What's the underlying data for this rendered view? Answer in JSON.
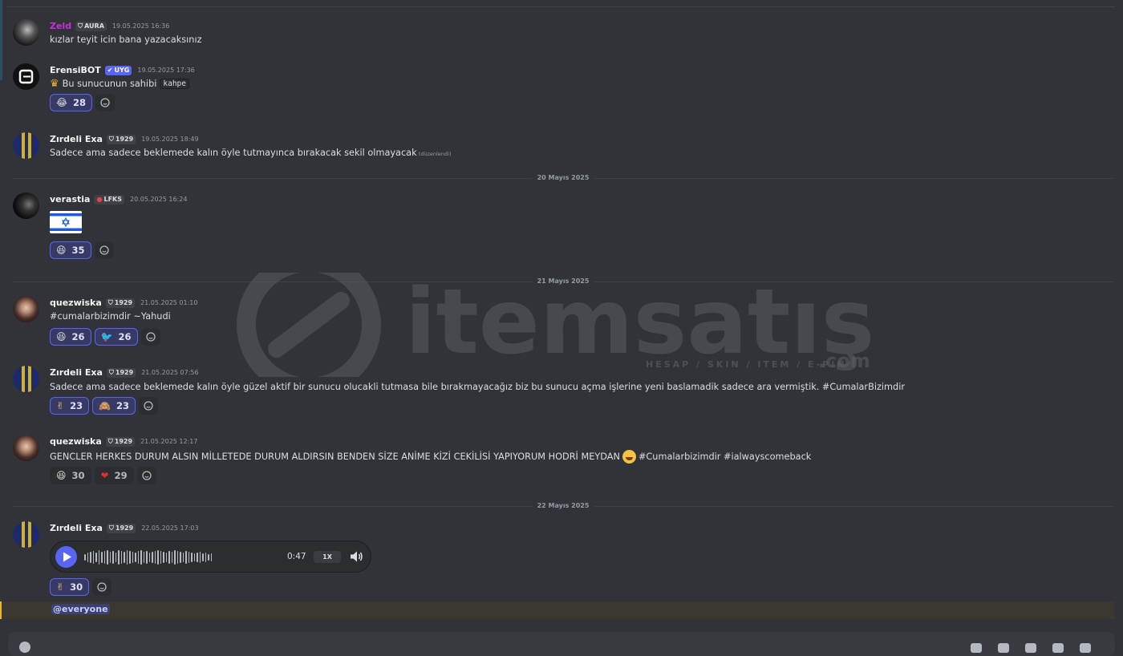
{
  "messages": [
    {
      "user": "Zeld",
      "tag": "AURA",
      "time": "19.05.2025 16:36",
      "text": "kızlar teyit icin bana yazacaksınız"
    },
    {
      "user": "ErensiBOT",
      "tag": "UYG",
      "time": "19.05.2025 17:36",
      "text": "Bu sunucunun sahibi",
      "code": "kahpe",
      "reactions": [
        {
          "emoji": "😂",
          "count": "28"
        }
      ]
    },
    {
      "user": "Zırdeli Exa",
      "tag": "1929",
      "time": "19.05.2025 18:49",
      "text": "Sadece ama sadece beklemede kalın öyle tutmayınca bırakacak sekil olmayacak",
      "edited": "(düzenlendi)"
    },
    {
      "user": "verastia",
      "tag": "LFKS",
      "time": "20.05.2025 16:24",
      "reactions": [
        {
          "emoji": "😆",
          "count": "35"
        }
      ]
    },
    {
      "user": "quezwiska",
      "tag": "1929",
      "time": "21.05.2025 01:10",
      "text": "#cumalarbizimdir ~Yahudi",
      "reactions": [
        {
          "emoji": "😆",
          "count": "26"
        },
        {
          "emoji": "🐦",
          "count": "26"
        }
      ]
    },
    {
      "user": "Zırdeli Exa",
      "tag": "1929",
      "time": "21.05.2025 07:56",
      "text": "Sadece ama sadece beklemede kalın öyle güzel aktif bir sunucu olucakli tutmasa bile bırakmayacağız biz bu sunucu açma işlerine yeni baslamadik sadece ara vermiştik. #CumalarBizimdir",
      "reactions": [
        {
          "emoji": "✌",
          "count": "23"
        },
        {
          "emoji": "🙈",
          "count": "23"
        }
      ]
    },
    {
      "user": "quezwiska",
      "tag": "1929",
      "time": "21.05.2025 12:17",
      "text": "GENCLER HERKES DURUM ALSIN MİLLETEDE DURUM ALDIRSIN BENDEN SİZE ANİME KİZİ CEKİLİSİ YAPIYORUM HODRİ MEYDAN",
      "text2": "#Cumalarbizimdir #ialwayscomeback",
      "reactions": [
        {
          "emoji": "😆",
          "count": "30"
        },
        {
          "emoji": "❤",
          "count": "29"
        }
      ]
    },
    {
      "user": "Zırdeli Exa",
      "tag": "1929",
      "time": "22.05.2025 17:03",
      "voice": {
        "duration": "0:47",
        "speed": "1X"
      },
      "reactions": [
        {
          "emoji": "✌",
          "count": "30"
        }
      ]
    }
  ],
  "dividers": [
    "20 Mayıs 2025",
    "21 Mayıs 2025",
    "22 Mayıs 2025"
  ],
  "mention": "@everyone",
  "watermark": {
    "brand": "itemsatış",
    "tagline": "HESAP / SKIN / ITEM / E-PIN",
    "suffix": ".com"
  },
  "colors": {
    "background": "#313338",
    "accent": "#5865f2",
    "zeld_name": "#c82fd8"
  }
}
